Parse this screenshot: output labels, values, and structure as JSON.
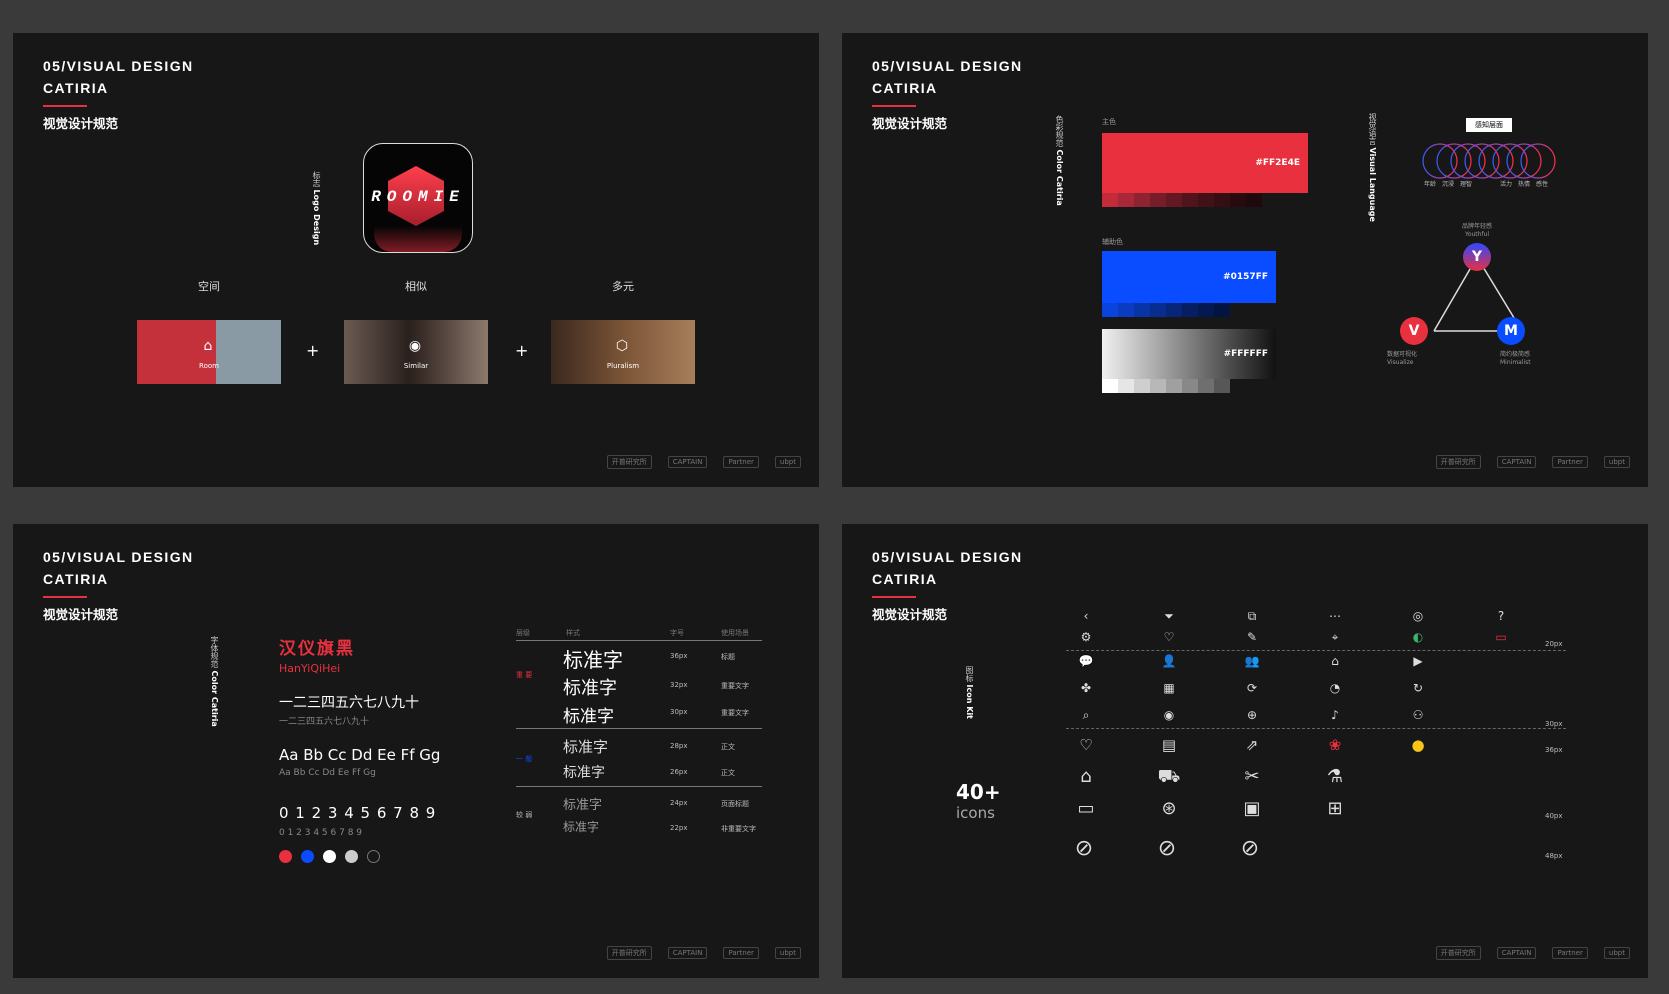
{
  "header": {
    "line1": "05/VISUAL DESIGN",
    "line2": "CATIRIA",
    "cn": "视觉设计规范"
  },
  "slide1": {
    "vlabel_cn": "标志",
    "vlabel_en": "Logo Design",
    "logo_word": "ROOMIE",
    "captions": [
      "空间",
      "相似",
      "多元"
    ],
    "photos": [
      {
        "label": "Room",
        "icon": "⌂",
        "icon_name": "house-outline-icon"
      },
      {
        "label": "Similar",
        "icon": "◉",
        "icon_name": "eye-icon"
      },
      {
        "label": "Pluralism",
        "icon": "⬡",
        "icon_name": "cube-icon"
      }
    ],
    "plus": "+"
  },
  "slide2": {
    "vlabel_cn": "色彩规范",
    "vlabel_en": "Color Catiria",
    "main_label": "主色",
    "aux_label": "辅助色",
    "red_code": "#FF2E4E",
    "blue_code": "#0157FF",
    "white_code": "#FFFFFF",
    "colors": {
      "red": "#e8303f",
      "blue": "#0a4cff",
      "white": "#ffffff"
    },
    "vlabel2_cn": "视觉语言",
    "vlabel2_en": "Visual Language",
    "tag": "感知层面",
    "ring_left": [
      "年龄",
      "沉浸",
      "理智"
    ],
    "ring_right": [
      "活力",
      "热情",
      "感性"
    ],
    "top_cn": "品牌年轻感",
    "top_en": "Youthful",
    "left_cn": "数据可视化",
    "left_en": "Visualize",
    "right_cn": "简约极简感",
    "right_en": "Minimalist",
    "Y": "Y",
    "V": "V",
    "M": "M"
  },
  "slide3": {
    "vlabel_cn": "字体规范",
    "vlabel_en": "Color Catiria",
    "font_name_cn": "汉仪旗黑",
    "font_name_en": "HanYiQiHei",
    "cn_big": "一二三四五六七八九十",
    "cn_small": "一二三四五六七八九十",
    "latin_big": "Aa Bb Cc Dd Ee Ff Gg",
    "latin_small": "Aa Bb Cc Dd Ee Ff Gg",
    "num_big": "0 1 2 3 4 5 6 7 8 9",
    "num_small": "0 1 2 3 4 5 6 7 8 9",
    "table_headers": [
      "层级",
      "样式",
      "字号",
      "使用场景"
    ],
    "levels": [
      "重 要",
      "一 般",
      "较 弱"
    ],
    "rows": [
      {
        "sample": "标准字",
        "size": "36px",
        "use": "标题"
      },
      {
        "sample": "标准字",
        "size": "32px",
        "use": "重要文字"
      },
      {
        "sample": "标准字",
        "size": "30px",
        "use": "重要文字"
      },
      {
        "sample": "标准字",
        "size": "28px",
        "use": "正文"
      },
      {
        "sample": "标准字",
        "size": "26px",
        "use": "正文"
      },
      {
        "sample": "标准字",
        "size": "24px",
        "use": "页面标题"
      },
      {
        "sample": "标准字",
        "size": "22px",
        "use": "非重要文字"
      }
    ]
  },
  "slide4": {
    "vlabel_cn": "图标",
    "vlabel_en": "Icon Kit",
    "count": "40+",
    "count_label": "icons",
    "sizes": [
      "20px",
      "30px",
      "36px",
      "40px",
      "48px"
    ]
  },
  "footer": {
    "logos": [
      "开普研究所",
      "CAPTAIN",
      "Partner",
      "ubpt"
    ]
  }
}
